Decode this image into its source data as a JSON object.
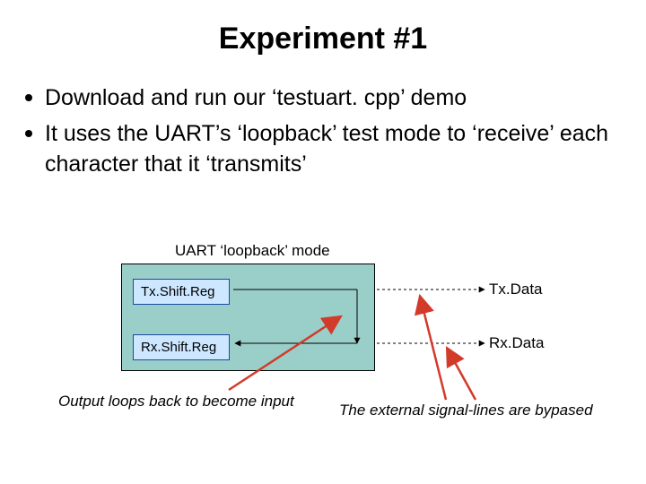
{
  "title": "Experiment #1",
  "bullets": [
    "Download and run our ‘testuart. cpp’ demo",
    "It uses the UART’s ‘loopback’ test mode to ‘receive’ each character that it ‘transmits’"
  ],
  "diagram": {
    "mode_label": "UART ‘loopback’ mode",
    "tx_reg": "Tx.Shift.Reg",
    "rx_reg": "Rx.Shift.Reg",
    "tx_data": "Tx.Data",
    "rx_data": "Rx.Data",
    "caption_left": "Output loops back to become input",
    "caption_right": "The external signal-lines are bypased"
  },
  "colors": {
    "uart_bg": "#9acec8",
    "reg_bg": "#cce7ff",
    "arrow_red": "#d23a2a"
  }
}
